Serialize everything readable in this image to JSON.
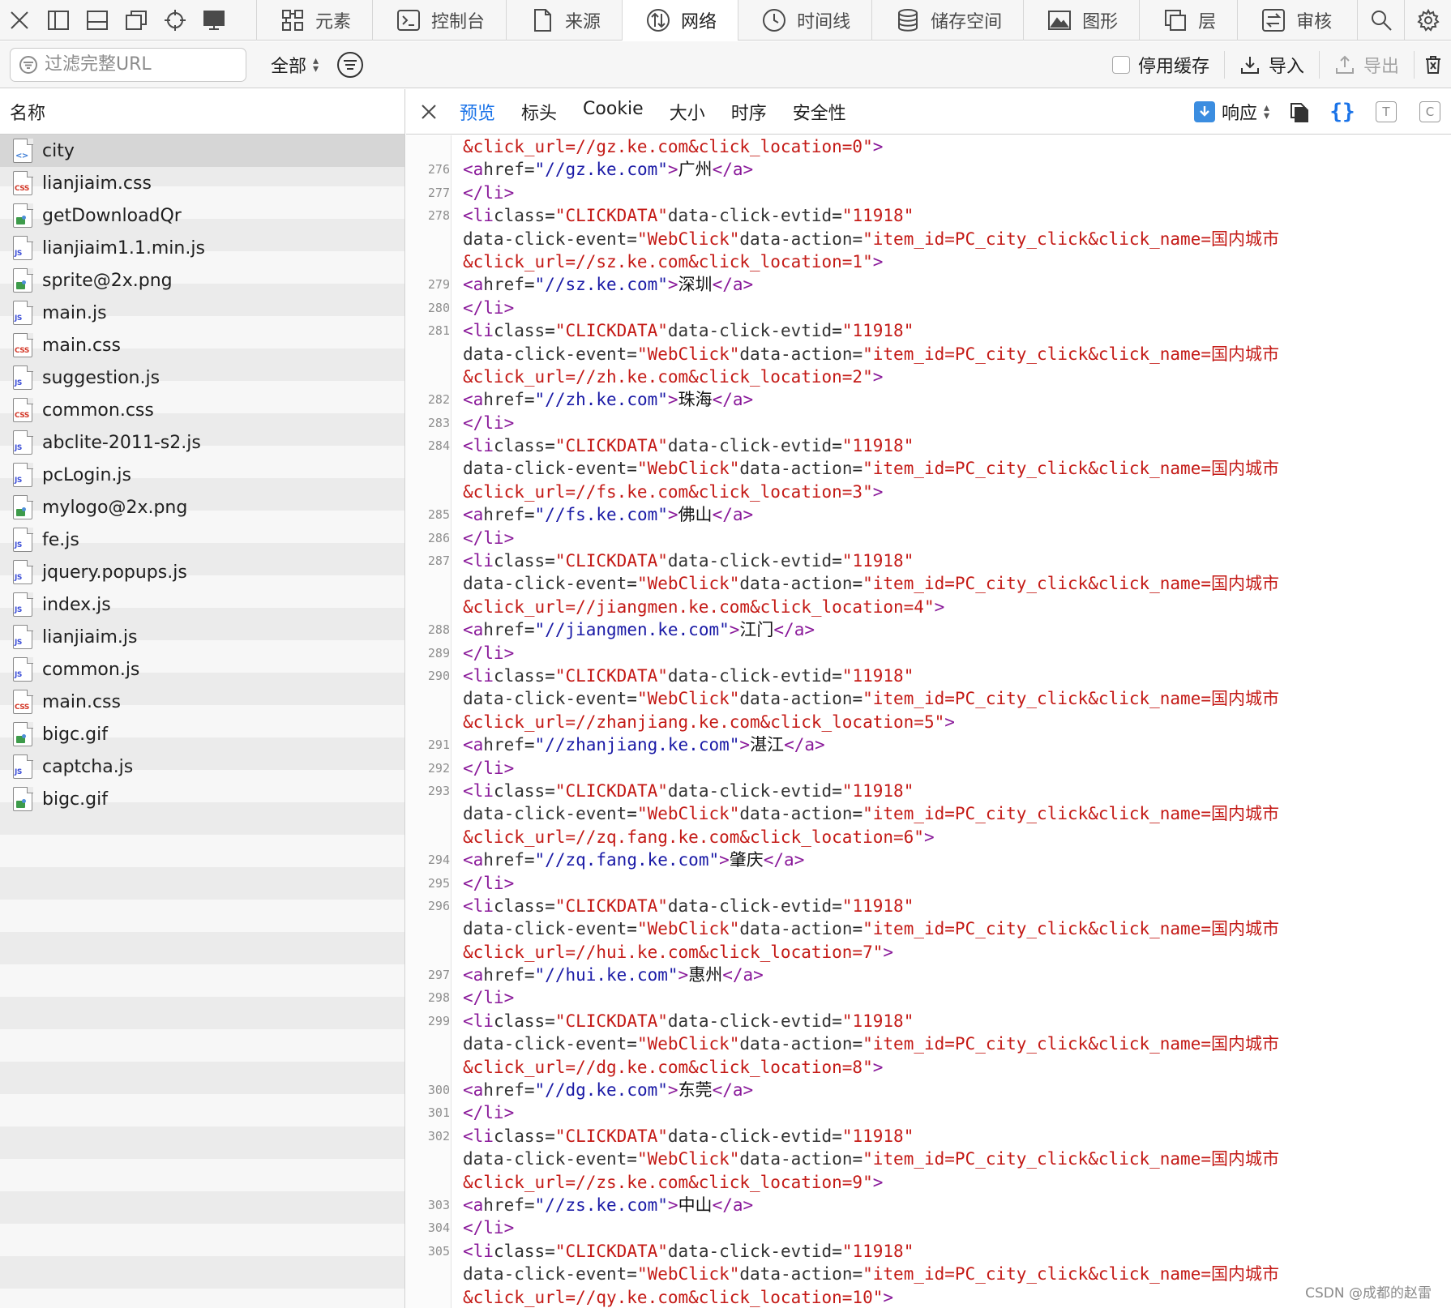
{
  "toolbar": {
    "tabs": [
      {
        "label": "元素",
        "icon": "elements-icon"
      },
      {
        "label": "控制台",
        "icon": "console-icon"
      },
      {
        "label": "来源",
        "icon": "sources-icon"
      },
      {
        "label": "网络",
        "icon": "network-icon",
        "active": true
      },
      {
        "label": "时间线",
        "icon": "timeline-icon"
      },
      {
        "label": "储存空间",
        "icon": "storage-icon"
      },
      {
        "label": "图形",
        "icon": "graphics-icon"
      },
      {
        "label": "层",
        "icon": "layers-icon"
      },
      {
        "label": "审核",
        "icon": "audit-icon"
      }
    ]
  },
  "filterbar": {
    "filter_placeholder": "过滤完整URL",
    "type_filter": "全部",
    "disable_cache": "停用缓存",
    "import": "导入",
    "export": "导出"
  },
  "resources": {
    "header": "名称",
    "items": [
      {
        "name": "city",
        "type": "doc",
        "selected": true
      },
      {
        "name": "lianjiaim.css",
        "type": "css"
      },
      {
        "name": "getDownloadQr",
        "type": "img"
      },
      {
        "name": "lianjiaim1.1.min.js",
        "type": "js"
      },
      {
        "name": "sprite@2x.png",
        "type": "img"
      },
      {
        "name": "main.js",
        "type": "js"
      },
      {
        "name": "main.css",
        "type": "css"
      },
      {
        "name": "suggestion.js",
        "type": "js"
      },
      {
        "name": "common.css",
        "type": "css"
      },
      {
        "name": "abclite-2011-s2.js",
        "type": "js"
      },
      {
        "name": "pcLogin.js",
        "type": "js"
      },
      {
        "name": "mylogo@2x.png",
        "type": "img"
      },
      {
        "name": "fe.js",
        "type": "js"
      },
      {
        "name": "jquery.popups.js",
        "type": "js"
      },
      {
        "name": "index.js",
        "type": "js"
      },
      {
        "name": "lianjiaim.js",
        "type": "js"
      },
      {
        "name": "common.js",
        "type": "js"
      },
      {
        "name": "main.css",
        "type": "css"
      },
      {
        "name": "bigc.gif",
        "type": "img"
      },
      {
        "name": "captcha.js",
        "type": "js"
      },
      {
        "name": "bigc.gif",
        "type": "img"
      }
    ]
  },
  "detail": {
    "tabs": [
      "预览",
      "标头",
      "Cookie",
      "大小",
      "时序",
      "安全性"
    ],
    "active_tab": "预览",
    "response_select": "响应",
    "format_icon_label": "{}",
    "text_icon_label": "T",
    "c_icon_label": "C"
  },
  "code": {
    "li_attrs": {
      "class": "CLICKDATA",
      "evtid": "11918",
      "event": "WebClick",
      "action_prefix": "item_id=PC_city_click&click_name=国内城市"
    },
    "first_line": "&click_url=//gz.ke.com&click_location=0\">",
    "first_entry": {
      "link_ln": "276",
      "close_ln": "277",
      "host": "gz.ke.com",
      "city": "广州"
    },
    "entries": [
      {
        "li_ln": "278",
        "link_ln": "279",
        "close_ln": "280",
        "host": "sz.ke.com",
        "city": "深圳",
        "loc": "1"
      },
      {
        "li_ln": "281",
        "link_ln": "282",
        "close_ln": "283",
        "host": "zh.ke.com",
        "city": "珠海",
        "loc": "2"
      },
      {
        "li_ln": "284",
        "link_ln": "285",
        "close_ln": "286",
        "host": "fs.ke.com",
        "city": "佛山",
        "loc": "3"
      },
      {
        "li_ln": "287",
        "link_ln": "288",
        "close_ln": "289",
        "host": "jiangmen.ke.com",
        "city": "江门",
        "loc": "4"
      },
      {
        "li_ln": "290",
        "link_ln": "291",
        "close_ln": "292",
        "host": "zhanjiang.ke.com",
        "city": "湛江",
        "loc": "5"
      },
      {
        "li_ln": "293",
        "link_ln": "294",
        "close_ln": "295",
        "host": "zq.fang.ke.com",
        "city": "肇庆",
        "loc": "6"
      },
      {
        "li_ln": "296",
        "link_ln": "297",
        "close_ln": "298",
        "host": "hui.ke.com",
        "city": "惠州",
        "loc": "7"
      },
      {
        "li_ln": "299",
        "link_ln": "300",
        "close_ln": "301",
        "host": "dg.ke.com",
        "city": "东莞",
        "loc": "8"
      },
      {
        "li_ln": "302",
        "link_ln": "303",
        "close_ln": "304",
        "host": "zs.ke.com",
        "city": "中山",
        "loc": "9"
      },
      {
        "li_ln": "305",
        "host": "qy.ke.com",
        "loc": "10"
      }
    ]
  },
  "watermark": "CSDN @成都的赵雷"
}
